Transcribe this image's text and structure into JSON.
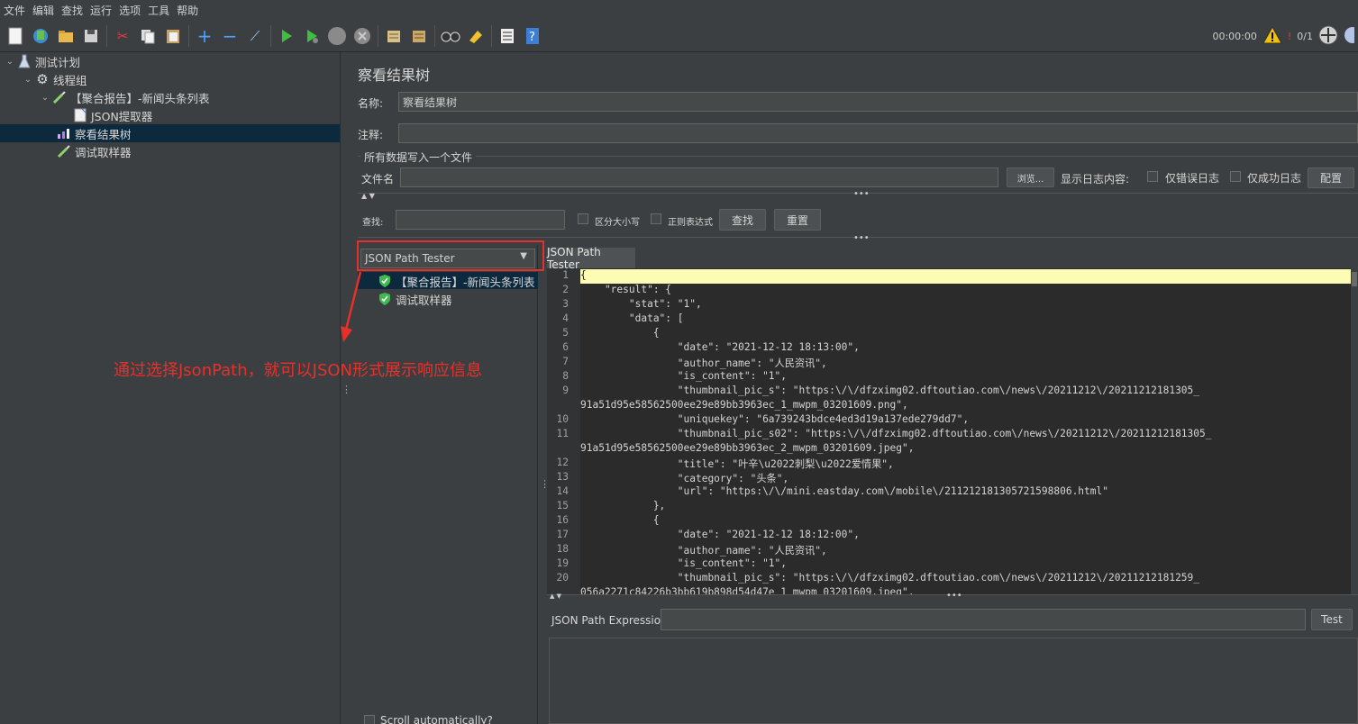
{
  "menu": [
    "文件",
    "编辑",
    "查找",
    "运行",
    "选项",
    "工具",
    "帮助"
  ],
  "toolbar": {
    "timer": "00:00:00",
    "counter": "0/1",
    "warn_count": "!",
    "icons": [
      "new-icon",
      "templates-icon",
      "open-icon",
      "save-icon",
      "cut-icon",
      "copy-icon",
      "paste-icon",
      "expand-icon",
      "collapse-icon",
      "toggle-icon",
      "start-icon",
      "start-no-pause-icon",
      "stop-icon",
      "shutdown-icon",
      "clear-icon",
      "clear-all-icon",
      "search-icon",
      "reset-search-icon",
      "function-helper-icon",
      "help-icon"
    ]
  },
  "tree": {
    "items": [
      {
        "label": "测试计划"
      },
      {
        "label": "线程组"
      },
      {
        "label": "【聚合报告】-新闻头条列表"
      },
      {
        "label": "JSON提取器"
      },
      {
        "label": "察看结果树"
      },
      {
        "label": "调试取样器"
      }
    ]
  },
  "panel": {
    "title": "察看结果树",
    "name_label": "名称:",
    "name_value": "察看结果树",
    "comment_label": "注释:",
    "comment_value": "",
    "write_all_label": "所有数据写入一个文件",
    "filename_label": "文件名",
    "filename_value": "",
    "browse_label": "浏览...",
    "log_display_label": "显示日志内容:",
    "errors_only_label": "仅错误日志",
    "success_only_label": "仅成功日志",
    "configure_label": "配置",
    "search_label": "查找:",
    "search_value": "",
    "case_sensitive_label": "区分大小写",
    "regex_label": "正则表达式",
    "find_button": "查找",
    "reset_button": "重置"
  },
  "renderer": {
    "selected": "JSON Path Tester",
    "results": [
      {
        "label": "【聚合报告】-新闻头条列表"
      },
      {
        "label": "调试取样器"
      }
    ],
    "scroll_auto_label": "Scroll automatically?",
    "tab_label": "JSON Path Tester"
  },
  "annotation": {
    "text": "通过选择JsonPath，就可以JSON形式展示响应信息",
    "color": "#e8302b"
  },
  "code": {
    "lines": [
      {
        "n": "1",
        "t": "{"
      },
      {
        "n": "2",
        "t": "    \"result\": {"
      },
      {
        "n": "3",
        "t": "        \"stat\": \"1\","
      },
      {
        "n": "4",
        "t": "        \"data\": ["
      },
      {
        "n": "5",
        "t": "            {"
      },
      {
        "n": "6",
        "t": "                \"date\": \"2021-12-12 18:13:00\","
      },
      {
        "n": "7",
        "t": "                \"author_name\": \"人民资讯\","
      },
      {
        "n": "8",
        "t": "                \"is_content\": \"1\","
      },
      {
        "n": "9",
        "t": "                \"thumbnail_pic_s\": \"https:\\/\\/dfzximg02.dftoutiao.com\\/news\\/20211212\\/20211212181305_"
      },
      {
        "n": "",
        "t": "91a51d95e58562500ee29e89bb3963ec_1_mwpm_03201609.png\","
      },
      {
        "n": "10",
        "t": "                \"uniquekey\": \"6a739243bdce4ed3d19a137ede279dd7\","
      },
      {
        "n": "11",
        "t": "                \"thumbnail_pic_s02\": \"https:\\/\\/dfzximg02.dftoutiao.com\\/news\\/20211212\\/20211212181305_"
      },
      {
        "n": "",
        "t": "91a51d95e58562500ee29e89bb3963ec_2_mwpm_03201609.jpeg\","
      },
      {
        "n": "12",
        "t": "                \"title\": \"叶辛\\u2022刺梨\\u2022爱情果\","
      },
      {
        "n": "13",
        "t": "                \"category\": \"头条\","
      },
      {
        "n": "14",
        "t": "                \"url\": \"https:\\/\\/mini.eastday.com\\/mobile\\/211212181305721598806.html\""
      },
      {
        "n": "15",
        "t": "            },"
      },
      {
        "n": "16",
        "t": "            {"
      },
      {
        "n": "17",
        "t": "                \"date\": \"2021-12-12 18:12:00\","
      },
      {
        "n": "18",
        "t": "                \"author_name\": \"人民资讯\","
      },
      {
        "n": "19",
        "t": "                \"is_content\": \"1\","
      },
      {
        "n": "20",
        "t": "                \"thumbnail_pic_s\": \"https:\\/\\/dfzximg02.dftoutiao.com\\/news\\/20211212\\/20211212181259_"
      },
      {
        "n": "",
        "t": "056a2271c84226b3bb619b898d54d47e_1_mwpm_03201609.jpeg\","
      }
    ]
  },
  "jsonpath": {
    "expr_label": "JSON Path Expression",
    "expr_value": "",
    "test_button": "Test"
  }
}
